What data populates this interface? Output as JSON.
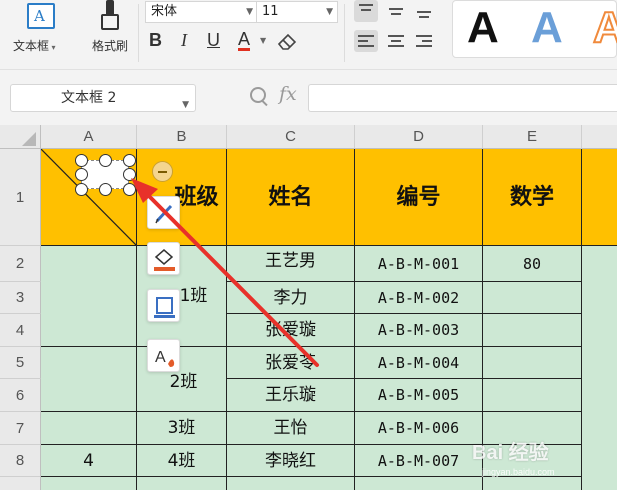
{
  "ribbon": {
    "textbox_label": "文本框",
    "textbox_icon_glyph": "A",
    "format_painter_label": "格式刷",
    "font_name": "宋体",
    "font_size": "11",
    "bold_glyph": "B",
    "italic_glyph": "I",
    "underline_glyph": "U",
    "font_color_glyph": "A",
    "text_styles": [
      "A",
      "A",
      "A"
    ],
    "colors": {
      "style_black": "#111111",
      "style_blue": "#6b9fd8",
      "style_orange": "#f08a3c",
      "font_color_bar": "#e03020"
    }
  },
  "namebar": {
    "name_box_value": "文本框 2",
    "fx_label": "fx"
  },
  "sheet": {
    "columns": [
      "A",
      "B",
      "C",
      "D",
      "E"
    ],
    "rows": [
      "1",
      "2",
      "3",
      "4",
      "5",
      "6",
      "7",
      "8"
    ],
    "header": {
      "b": "班级",
      "c": "姓名",
      "d": "编号",
      "e": "数学"
    },
    "b_values": {
      "b1": "1班",
      "b2": "2班",
      "b3": "3班",
      "b4": "4班"
    },
    "names": [
      "王艺男",
      "李力",
      "张爱璇",
      "张爱苓",
      "王乐璇",
      "王怡",
      "李晓红"
    ],
    "ids": [
      "A-B-M-001",
      "A-B-M-002",
      "A-B-M-003",
      "A-B-M-004",
      "A-B-M-005",
      "A-B-M-006",
      "A-B-M-007"
    ],
    "e_row2": "80",
    "a_row8": "4",
    "colors": {
      "header_fill": "#ffc000",
      "body_fill": "#cde8d4",
      "arrow": "#e8312a"
    }
  },
  "watermark": {
    "main": "Bai 经验",
    "sub": "jingyan.baidu.com"
  }
}
